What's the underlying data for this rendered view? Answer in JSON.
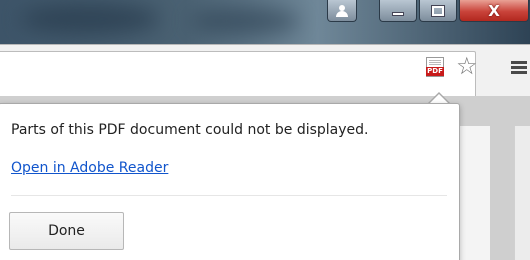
{
  "window": {
    "user_icon": "user-icon",
    "minimize_icon": "minimize-icon",
    "maximize_icon": "maximize-icon",
    "close_icon": "close-icon",
    "close_glyph": "X"
  },
  "toolbar": {
    "pdf_icon": "pdf-document-icon",
    "pdf_badge": "PDF",
    "star_icon": "star-icon",
    "star_glyph": "☆",
    "menu_icon": "menu-icon"
  },
  "bubble": {
    "message": "Parts of this PDF document could not be displayed.",
    "link_label": "Open in Adobe Reader",
    "done_label": "Done"
  },
  "colors": {
    "link": "#1155cc",
    "close_button": "#c9433a",
    "pdf_badge": "#c81a1a"
  }
}
